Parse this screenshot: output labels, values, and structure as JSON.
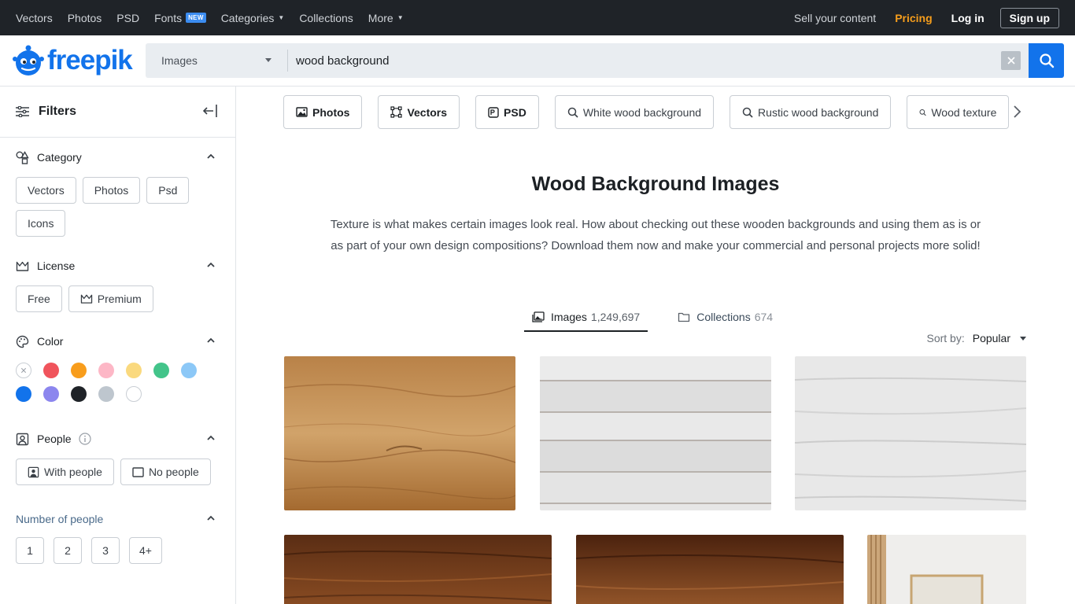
{
  "topbar": {
    "nav": [
      {
        "label": "Vectors"
      },
      {
        "label": "Photos"
      },
      {
        "label": "PSD"
      },
      {
        "label": "Fonts",
        "badge": "NEW"
      },
      {
        "label": "Categories",
        "caret": true
      },
      {
        "label": "Collections"
      },
      {
        "label": "More",
        "caret": true
      }
    ],
    "sell": "Sell your content",
    "pricing": "Pricing",
    "login": "Log in",
    "signup": "Sign up"
  },
  "header": {
    "logo": "freepik",
    "type_select": "Images",
    "search_value": "wood background"
  },
  "sidebar": {
    "title": "Filters",
    "category": {
      "label": "Category",
      "chips": [
        "Vectors",
        "Photos",
        "Psd",
        "Icons"
      ]
    },
    "license": {
      "label": "License",
      "chips": [
        "Free",
        "Premium"
      ]
    },
    "color": {
      "label": "Color",
      "swatches": [
        "none",
        "#f0545c",
        "#f89d1c",
        "#fdb7c6",
        "#fad97e",
        "#43c48a",
        "#8cc8f7",
        "#1273eb",
        "#8c86ee",
        "#1f2328",
        "#bec6ce",
        "#ffffff"
      ]
    },
    "people": {
      "label": "People",
      "chips": [
        "With people",
        "No people"
      ]
    },
    "number_of_people": {
      "label": "Number of people",
      "chips": [
        "1",
        "2",
        "3",
        "4+"
      ]
    }
  },
  "main": {
    "tags": [
      {
        "label": "Photos",
        "icon": "image-icon"
      },
      {
        "label": "Vectors",
        "icon": "vector-icon"
      },
      {
        "label": "PSD",
        "icon": "psd-icon"
      },
      {
        "label": "White wood background",
        "icon": "search-icon"
      },
      {
        "label": "Rustic wood background",
        "icon": "search-icon"
      },
      {
        "label": "Wood texture",
        "icon": "search-icon"
      }
    ],
    "title": "Wood Background Images",
    "description": "Texture is what makes certain images look real. How about checking out these wooden backgrounds and using them as is or as part of your own design compositions? Download them now and make your commercial and personal projects more solid!",
    "tabs": [
      {
        "label": "Images",
        "count": "1,249,697"
      },
      {
        "label": "Collections",
        "count": "674"
      }
    ],
    "sort_label": "Sort by:",
    "sort_value": "Popular"
  },
  "colors": {
    "accent": "#1273eb",
    "topbar_bg": "#1f2328",
    "pricing": "#f59d1c"
  }
}
